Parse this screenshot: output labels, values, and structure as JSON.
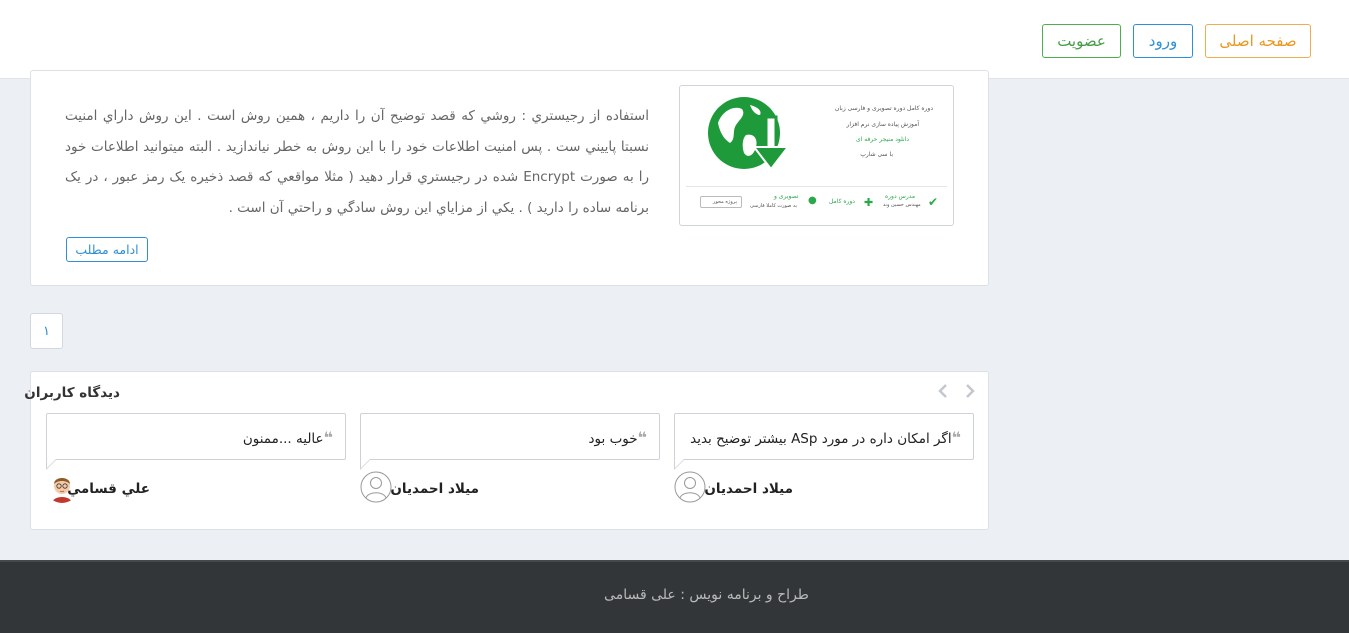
{
  "nav": {
    "home": "صفحه اصلی",
    "login": "ورود",
    "register": "عضويت"
  },
  "post": {
    "excerpt": "استفاده از رجيستري : روشي که قصد توضيح آن را داريم ، همين روش است . اين روش داراي امنيت نسبتا پاييني ست . پس امنيت اطلاعات خود را با اين روش به خطر نياندازيد . البته ميتوانيد اطلاعات خود را به صورت Encrypt شده در رجيستري قرار دهيد ( مثلا مواقعي که قصد ذخيره يک رمز عبور ، در يک برنامه ساده را داريد ) . يکي از مزاياي اين روش سادگي و راحتي آن است .",
    "read_more": "ادامه مطلب",
    "thumbnail": {
      "line1": "دوره کامل دوره تصویری و فارسی زبان",
      "line2": "آموزش پیاده سازی نرم افزار",
      "line3": "دانلود منیجر حرفه ای",
      "line4": "با سی شارپ",
      "footer": {
        "teacher": "مدرس دوره",
        "teacher_name": "مهندس حسین وند",
        "full_course": "دوره کامل",
        "video": "تصویری و",
        "video_sub": "به صورت کاملا فارسی",
        "project": "پروژه محور"
      }
    }
  },
  "pagination": {
    "current": "۱"
  },
  "comments": {
    "title": "ديدگاه کاربران",
    "items": [
      {
        "text": "اگر امکان داره در مورد ASp بيشتر توضيح بديد",
        "author": "ميلاد احمديان",
        "avatar": "default-user-icon"
      },
      {
        "text": "خوب بود",
        "author": "ميلاد احمديان",
        "avatar": "default-user-icon"
      },
      {
        "text": "عاليه ...ممنون",
        "author": "علي قسامي",
        "avatar": "cartoon-user-avatar"
      }
    ]
  },
  "footer": {
    "credit": "طراح و برنامه نويس : علی قسامی"
  },
  "colors": {
    "accent_blue": "#2f8fd6",
    "orange": "#f0ad4e",
    "green": "#4cae4c",
    "footer_bg": "#333638"
  }
}
